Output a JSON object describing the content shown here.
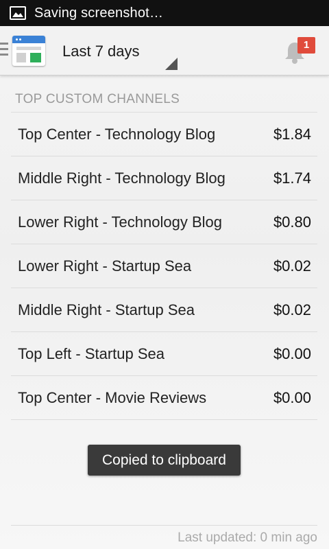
{
  "status_bar": {
    "text": "Saving screenshot…",
    "icon": "image-icon"
  },
  "action_bar": {
    "app_icon": "adsense-app-icon",
    "date_range": "Last 7 days",
    "notifications_icon": "bell-icon",
    "notifications_count": "1",
    "colors": {
      "badge": "#e04b3b",
      "accent": "#3b82d6"
    }
  },
  "section": {
    "title": "TOP CUSTOM CHANNELS"
  },
  "channels": [
    {
      "name": "Top Center - Technology Blog",
      "amount": "$1.84"
    },
    {
      "name": "Middle Right - Technology Blog",
      "amount": "$1.74"
    },
    {
      "name": "Lower Right - Technology Blog",
      "amount": "$0.80"
    },
    {
      "name": "Lower Right - Startup Sea",
      "amount": "$0.02"
    },
    {
      "name": "Middle Right - Startup Sea",
      "amount": "$0.02"
    },
    {
      "name": "Top Left - Startup Sea",
      "amount": "$0.00"
    },
    {
      "name": "Top Center - Movie Reviews",
      "amount": "$0.00"
    }
  ],
  "toast": "Copied to clipboard",
  "footer": {
    "last_updated": "Last updated: 0 min ago"
  }
}
